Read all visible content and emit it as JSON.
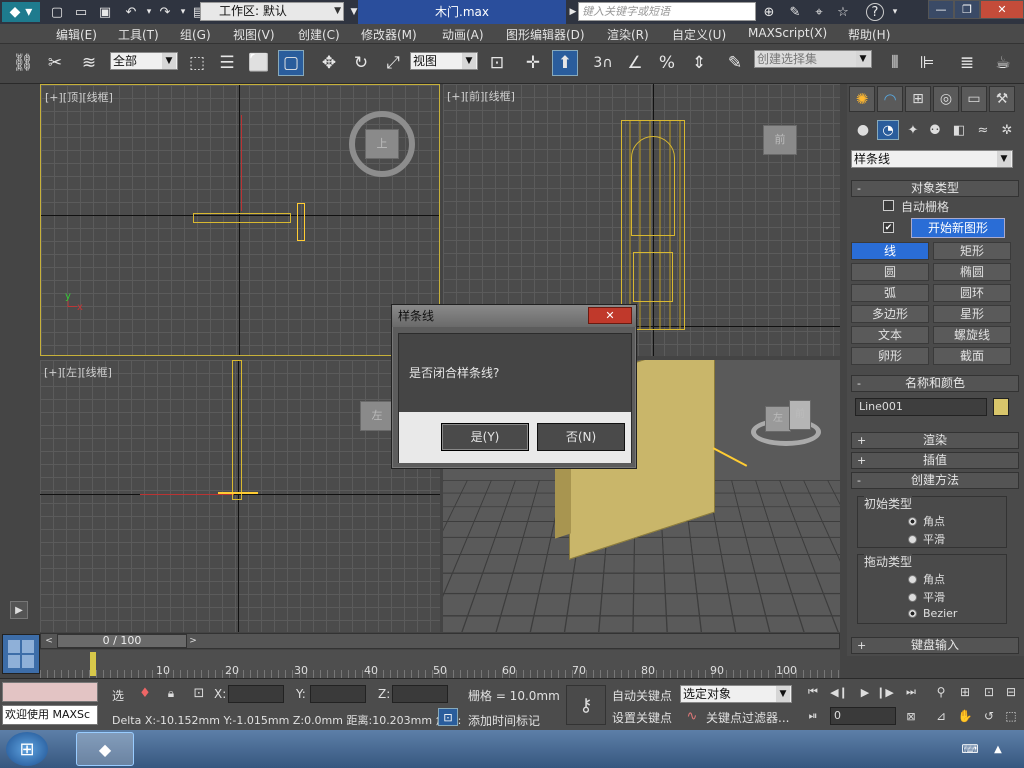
{
  "titlebar": {
    "workspace_label": "工作区: 默认",
    "doc_title": "木门.max",
    "search_placeholder": "键入关键字或短语"
  },
  "menu": [
    "编辑(E)",
    "工具(T)",
    "组(G)",
    "视图(V)",
    "创建(C)",
    "修改器(M)",
    "动画(A)",
    "图形编辑器(D)",
    "渲染(R)",
    "自定义(U)",
    "MAXScript(X)",
    "帮助(H)"
  ],
  "toolbar": {
    "filter_value": "全部",
    "refcoord_value": "视图",
    "snap_label": "3",
    "selection_set_placeholder": "创建选择集"
  },
  "viewports": {
    "top": "[+][顶][线框]",
    "front": "[+][前][线框]",
    "left": "[+][左][线框]",
    "top_cube": "上",
    "front_cube": "前",
    "left_cube": "左",
    "persp_cube_front": "左",
    "persp_cube_right": "前"
  },
  "command_panel": {
    "category_value": "样条线",
    "object_type_title": "对象类型",
    "auto_grid": "自动栅格",
    "start_new_shape": "开始新图形",
    "buttons": [
      "线",
      "矩形",
      "圆",
      "椭圆",
      "弧",
      "圆环",
      "多边形",
      "星形",
      "文本",
      "螺旋线",
      "卵形",
      "截面"
    ],
    "name_color_title": "名称和颜色",
    "object_name": "Line001",
    "render_title": "渲染",
    "interp_title": "插值",
    "creation_title": "创建方法",
    "initial_type_title": "初始类型",
    "initial_options": [
      "角点",
      "平滑"
    ],
    "drag_type_title": "拖动类型",
    "drag_options": [
      "角点",
      "平滑",
      "Bezier"
    ],
    "keyboard_title": "键盘输入",
    "object_color": "#d9c66b"
  },
  "dialog": {
    "title": "样条线",
    "close": "✕",
    "message": "是否闭合样条线?",
    "yes": "是(Y)",
    "no": "否(N)"
  },
  "timeline": {
    "frame_readout": "0 / 100",
    "ticks": [
      "10",
      "20",
      "30",
      "40",
      "50",
      "60",
      "70",
      "80",
      "90",
      "100"
    ]
  },
  "status": {
    "welcome": "欢迎使用 MAXSc",
    "select_label": "选",
    "x_label": "X:",
    "y_label": "Y:",
    "z_label": "Z:",
    "grid_label": "栅格 = 10.0mm",
    "delta_text": "Delta X:-10.152mm  Y:-1.015mm  Z:0.0mm  距离:10.203mm 角度:",
    "add_time_tag": "添加时间标记",
    "auto_key": "自动关键点",
    "set_key": "设置关键点",
    "key_mode_value": "选定对象",
    "key_filter": "关键点过滤器...",
    "frame_value": "0"
  },
  "accent": "#ffcc33"
}
